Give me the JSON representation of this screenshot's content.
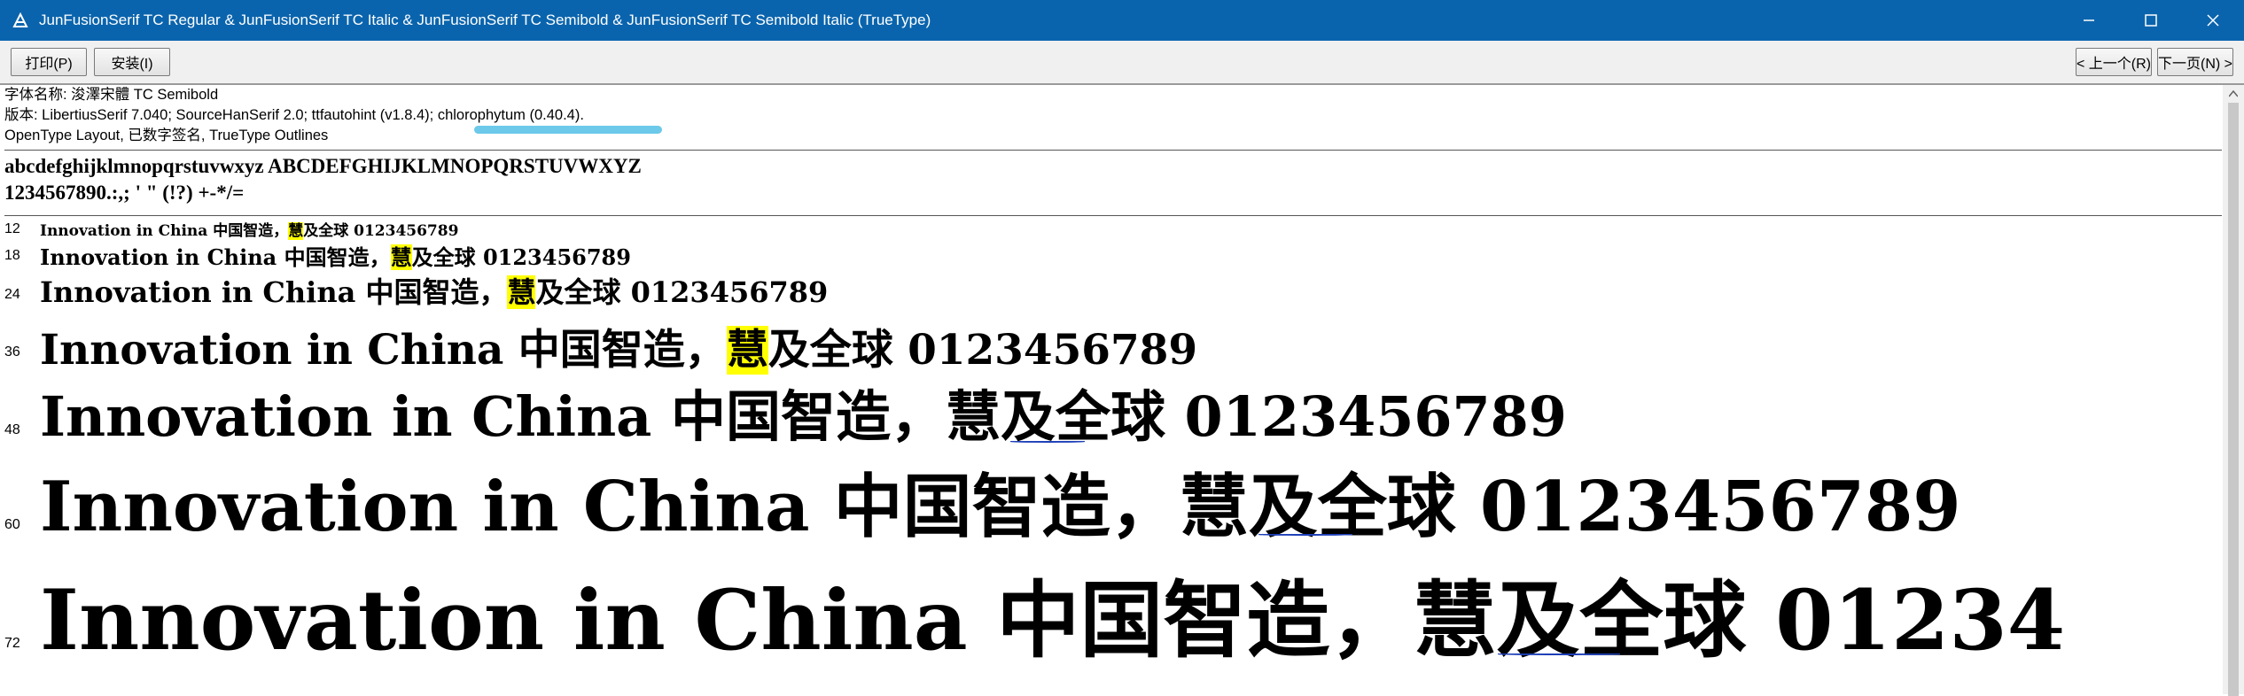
{
  "window": {
    "title": "JunFusionSerif TC Regular & JunFusionSerif TC Italic  & JunFusionSerif TC Semibold  & JunFusionSerif TC Semibold Italic  (TrueType)",
    "icon": "font-file-icon"
  },
  "toolbar": {
    "print_label": "打印(P)",
    "install_label": "安装(I)",
    "prev_label": "< 上一个(R)",
    "next_label": "下一页(N) >"
  },
  "info": {
    "font_name": "字体名称: 浚澤宋體 TC Semibold",
    "version": "版本: LibertiusSerif 7.040; SourceHanSerif 2.0; ttfautohint (v1.8.4); chlorophytum (0.40.4).",
    "features": "OpenType Layout, 已数字签名, TrueType Outlines"
  },
  "charset": {
    "letters": "abcdefghijklmnopqrstuvwxyz ABCDEFGHIJKLMNOPQRSTUVWXYZ",
    "digits": "1234567890.:,; ' \" (!?) +-*/="
  },
  "sample": {
    "before": "Innovation in China 中国智造，",
    "highlight": "慧",
    "after": "及全球 0123456789",
    "after_truncated": "及全球 01234"
  },
  "sizes": [
    "12",
    "18",
    "24",
    "36",
    "48",
    "60",
    "72"
  ],
  "colors": {
    "titlebar": "#0a64ad",
    "highlight": "#ffff00",
    "annotation_blue": "#1e3fb8",
    "annotation_cyan": "#5cc3e8"
  }
}
